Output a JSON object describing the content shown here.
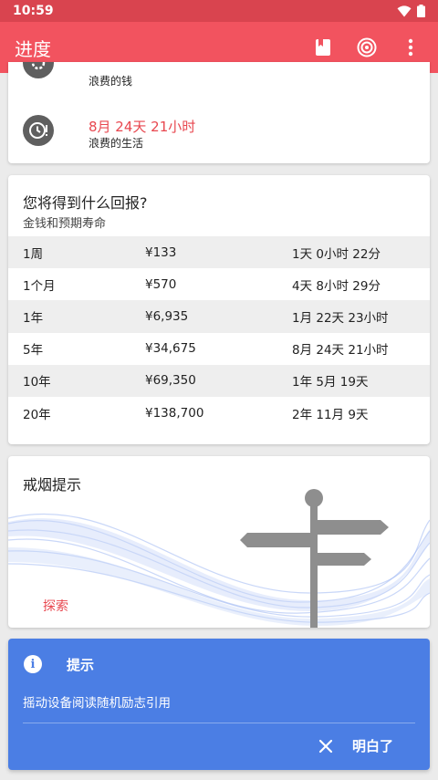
{
  "status_bar": {
    "time": "10:59"
  },
  "app_bar": {
    "title": "进度",
    "icons": [
      "book-icon",
      "target-icon",
      "more-vert-icon"
    ]
  },
  "stats": [
    {
      "value": "",
      "label": "浪费的钱",
      "icon": "gear-coin-icon"
    },
    {
      "value": "8月 24天 21小时",
      "label": "浪费的生活",
      "icon": "clock-alert-icon"
    }
  ],
  "rewards": {
    "title": "您将得到什么回报?",
    "subtitle": "金钱和预期寿命",
    "rows": [
      {
        "period": "1周",
        "money": "¥133",
        "life": "1天 0小时 22分"
      },
      {
        "period": "1个月",
        "money": "¥570",
        "life": "4天 8小时 29分"
      },
      {
        "period": "1年",
        "money": "¥6,935",
        "life": "1月 22天 23小时"
      },
      {
        "period": "5年",
        "money": "¥34,675",
        "life": "8月 24天 21小时"
      },
      {
        "period": "10年",
        "money": "¥69,350",
        "life": "1年 5月 19天"
      },
      {
        "period": "20年",
        "money": "¥138,700",
        "life": "2年 11月 9天"
      }
    ]
  },
  "tips": {
    "title": "戒烟提示",
    "explore_label": "探索"
  },
  "snackbar": {
    "title": "提示",
    "message": "摇动设备阅读随机励志引用",
    "ok_label": "明白了"
  },
  "colors": {
    "primary": "#f2535f",
    "status_bar": "#d9444f",
    "accent_text": "#e8474f",
    "snackbar": "#4b7ee4"
  }
}
